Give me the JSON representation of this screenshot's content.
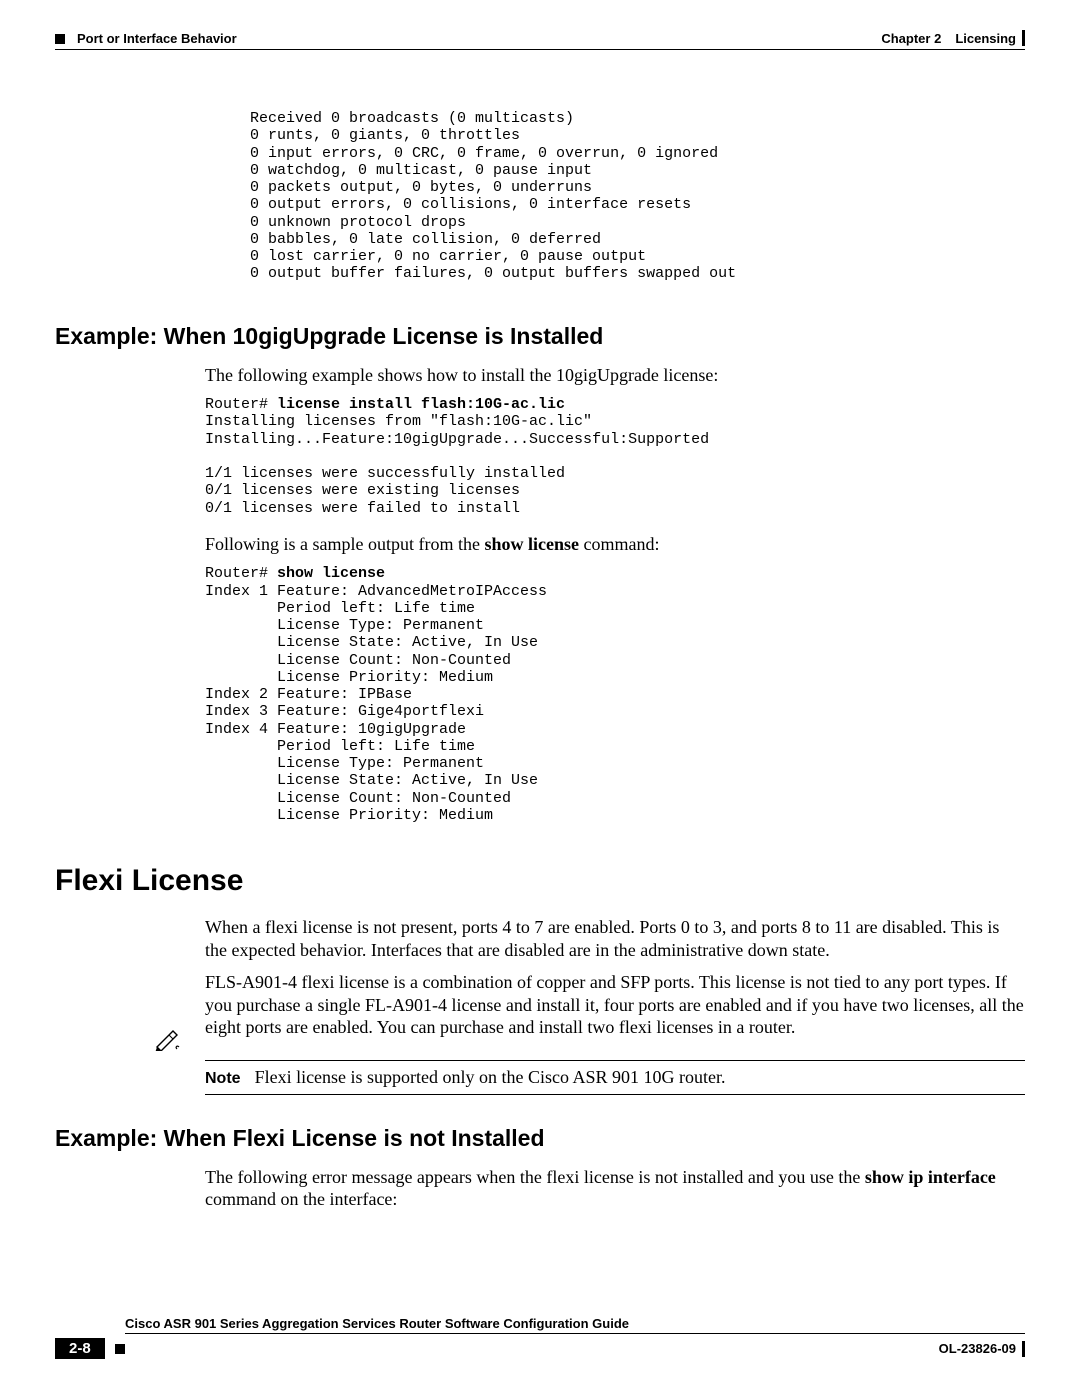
{
  "header": {
    "chapter_label": "Chapter 2",
    "chapter_title": "Licensing",
    "section": "Port or Interface Behavior"
  },
  "codeblock1": "   Received 0 broadcasts (0 multicasts)\n   0 runts, 0 giants, 0 throttles\n   0 input errors, 0 CRC, 0 frame, 0 overrun, 0 ignored\n   0 watchdog, 0 multicast, 0 pause input\n   0 packets output, 0 bytes, 0 underruns\n   0 output errors, 0 collisions, 0 interface resets\n   0 unknown protocol drops\n   0 babbles, 0 late collision, 0 deferred\n   0 lost carrier, 0 no carrier, 0 pause output\n   0 output buffer failures, 0 output buffers swapped out",
  "section1": {
    "heading": "Example: When 10gigUpgrade License is Installed",
    "intro": "The following example shows how to install the 10gigUpgrade license:",
    "code_prompt1": "Router# ",
    "code_cmd1": "license install flash:10G-ac.lic",
    "code_body1": "Installing licenses from \"flash:10G-ac.lic\"\nInstalling...Feature:10gigUpgrade...Successful:Supported\n\n1/1 licenses were successfully installed\n0/1 licenses were existing licenses\n0/1 licenses were failed to install",
    "following_text_pre": "Following is a sample output from the ",
    "following_cmd": "show license",
    "following_text_post": " command:",
    "code_prompt2": "Router# ",
    "code_cmd2": "show license",
    "code_body2": "Index 1 Feature: AdvancedMetroIPAccess\n        Period left: Life time\n        License Type: Permanent\n        License State: Active, In Use\n        License Count: Non-Counted\n        License Priority: Medium\nIndex 2 Feature: IPBase\nIndex 3 Feature: Gige4portflexi\nIndex 4 Feature: 10gigUpgrade\n        Period left: Life time\n        License Type: Permanent\n        License State: Active, In Use\n        License Count: Non-Counted\n        License Priority: Medium"
  },
  "section2": {
    "heading": "Flexi License",
    "p1": "When a flexi license is not present, ports 4 to 7 are enabled. Ports 0 to 3, and ports 8 to 11 are disabled. This is the expected behavior. Interfaces that are disabled are in the administrative down state.",
    "p2": "FLS-A901-4 flexi license is a combination of copper and SFP ports. This license is not tied to any port types. If you purchase a single FL-A901-4 license and install it, four ports are enabled and if you have two licenses, all the eight ports are enabled. You can purchase and install two flexi licenses in a router."
  },
  "note": {
    "label": "Note",
    "text": "Flexi license is supported only on the Cisco ASR 901 10G router."
  },
  "section3": {
    "heading": "Example: When Flexi License is not Installed",
    "p1_pre": "The following error message appears when the flexi license is not installed and you use the ",
    "p1_cmd": "show ip interface",
    "p1_post": " command on the interface:"
  },
  "footer": {
    "guide": "Cisco ASR 901 Series Aggregation Services Router Software Configuration Guide",
    "pagenum": "2-8",
    "docid": "OL-23826-09"
  }
}
